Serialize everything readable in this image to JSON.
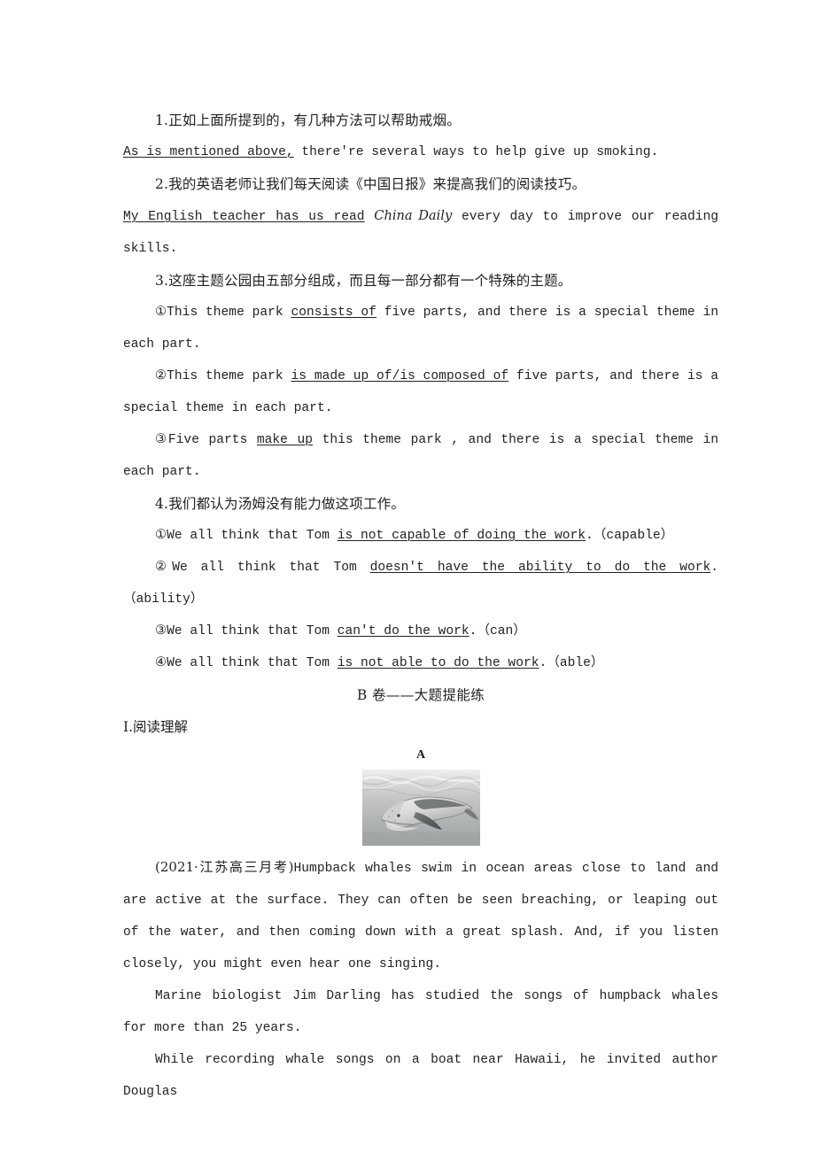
{
  "document": {
    "type": "chinese-english-exercise-worksheet",
    "items": [
      {
        "number": "1.",
        "chinese": "正如上面所提到的，有几种方法可以帮助戒烟。",
        "answer_underlined": "As is mentioned above,",
        "answer_rest": " there're several ways to help give up smoking."
      },
      {
        "number": "2.",
        "chinese": "我的英语老师让我们每天阅读《中国日报》来提高我们的阅读技巧。",
        "answer_underlined": "My English teacher has us read",
        "answer_italic": "China Daily",
        "answer_rest": " every day to improve our reading skills."
      },
      {
        "number": "3.",
        "chinese": "这座主题公园由五部分组成，而且每一部分都有一个特殊的主题。",
        "subitems": [
          {
            "marker": "①",
            "pre": "This theme park ",
            "underlined": "consists of",
            "post": " five parts, and there is a special theme in each part."
          },
          {
            "marker": "②",
            "pre": "This theme park ",
            "underlined": "is made up of/is composed of",
            "post": " five parts, and there is a special theme in each part."
          },
          {
            "marker": "③",
            "pre": "Five parts ",
            "underlined": "make up",
            "post": " this theme park , and there is a special theme in each part."
          }
        ]
      },
      {
        "number": "4.",
        "chinese": "我们都认为汤姆没有能力做这项工作。",
        "subitems": [
          {
            "marker": "①",
            "pre": "We all think that Tom ",
            "underlined": "is not capable of doing the work",
            "post": ".（capable）"
          },
          {
            "marker": "②",
            "pre": "We all think that Tom ",
            "underlined": "doesn't have the ability to do the work",
            "post": ".（ability）"
          },
          {
            "marker": "③",
            "pre": "We all think that Tom ",
            "underlined": "can't do the work",
            "post": ".（can）"
          },
          {
            "marker": "④",
            "pre": "We all think that Tom ",
            "underlined": "is not able to do the work",
            "post": ".（able）"
          }
        ]
      }
    ],
    "section_heading": "B 卷——大题提能练",
    "part_heading": "Ⅰ.阅读理解",
    "passage_label": "A",
    "figure": {
      "name": "humpback-whale-photo",
      "caption": "",
      "alt": "Grayscale photograph of a humpback whale swimming just beneath the ocean surface"
    },
    "passage": {
      "source_tag": "(2021·江苏高三月考)",
      "paragraph1_rest": "Humpback whales swim in ocean areas close to land and are active at the surface. They can often be seen breaching, or leaping out of the water, and then coming down with a great splash. And, if you listen closely, you might even hear one singing.",
      "paragraph2": "Marine biologist Jim Darling has studied the songs of humpback whales for more than 25 years.",
      "paragraph3": "While recording whale songs on a boat near Hawaii, he invited author Douglas"
    }
  }
}
